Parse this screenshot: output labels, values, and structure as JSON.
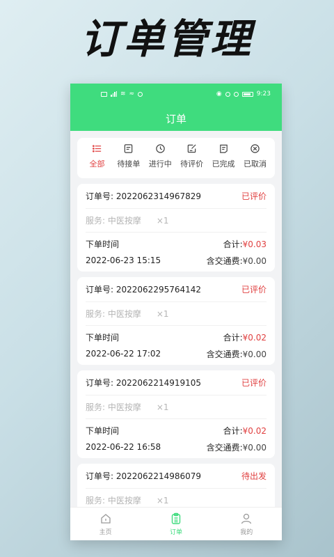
{
  "promo": {
    "title": "订单管理"
  },
  "status_bar": {
    "time": "9:23"
  },
  "header": {
    "title": "订单"
  },
  "tabs": [
    {
      "label": "全部",
      "icon": "list-icon",
      "active": true
    },
    {
      "label": "待接单",
      "icon": "document-icon",
      "active": false
    },
    {
      "label": "进行中",
      "icon": "clock-icon",
      "active": false
    },
    {
      "label": "待评价",
      "icon": "edit-note-icon",
      "active": false
    },
    {
      "label": "已完成",
      "icon": "check-doc-icon",
      "active": false
    },
    {
      "label": "已取消",
      "icon": "cancel-circle-icon",
      "active": false
    }
  ],
  "orders": [
    {
      "order_label": "订单号:",
      "order_no": "2022062314967829",
      "status": "已评价",
      "service": "服务: 中医按摩",
      "qty": "×1",
      "time_label": "下单时间",
      "time": "2022-06-23 15:15",
      "total_label": "合计:",
      "total": "¥0.03",
      "fee_label": "含交通费:",
      "fee": "¥0.00"
    },
    {
      "order_label": "订单号:",
      "order_no": "2022062295764142",
      "status": "已评价",
      "service": "服务: 中医按摩",
      "qty": "×1",
      "time_label": "下单时间",
      "time": "2022-06-22 17:02",
      "total_label": "合计:",
      "total": "¥0.02",
      "fee_label": "含交通费:",
      "fee": "¥0.00"
    },
    {
      "order_label": "订单号:",
      "order_no": "2022062214919105",
      "status": "已评价",
      "service": "服务: 中医按摩",
      "qty": "×1",
      "time_label": "下单时间",
      "time": "2022-06-22 16:58",
      "total_label": "合计:",
      "total": "¥0.02",
      "fee_label": "含交通费:",
      "fee": "¥0.00"
    },
    {
      "order_label": "订单号:",
      "order_no": "2022062214986079",
      "status": "待出发",
      "service": "服务: 中医按摩",
      "qty": "×1"
    }
  ],
  "bottom_nav": [
    {
      "label": "主页",
      "icon": "home-icon",
      "active": false
    },
    {
      "label": "订单",
      "icon": "order-icon",
      "active": true
    },
    {
      "label": "我的",
      "icon": "user-icon",
      "active": false
    }
  ],
  "colors": {
    "brand": "#3fdc7e",
    "accent_red": "#e04040"
  }
}
